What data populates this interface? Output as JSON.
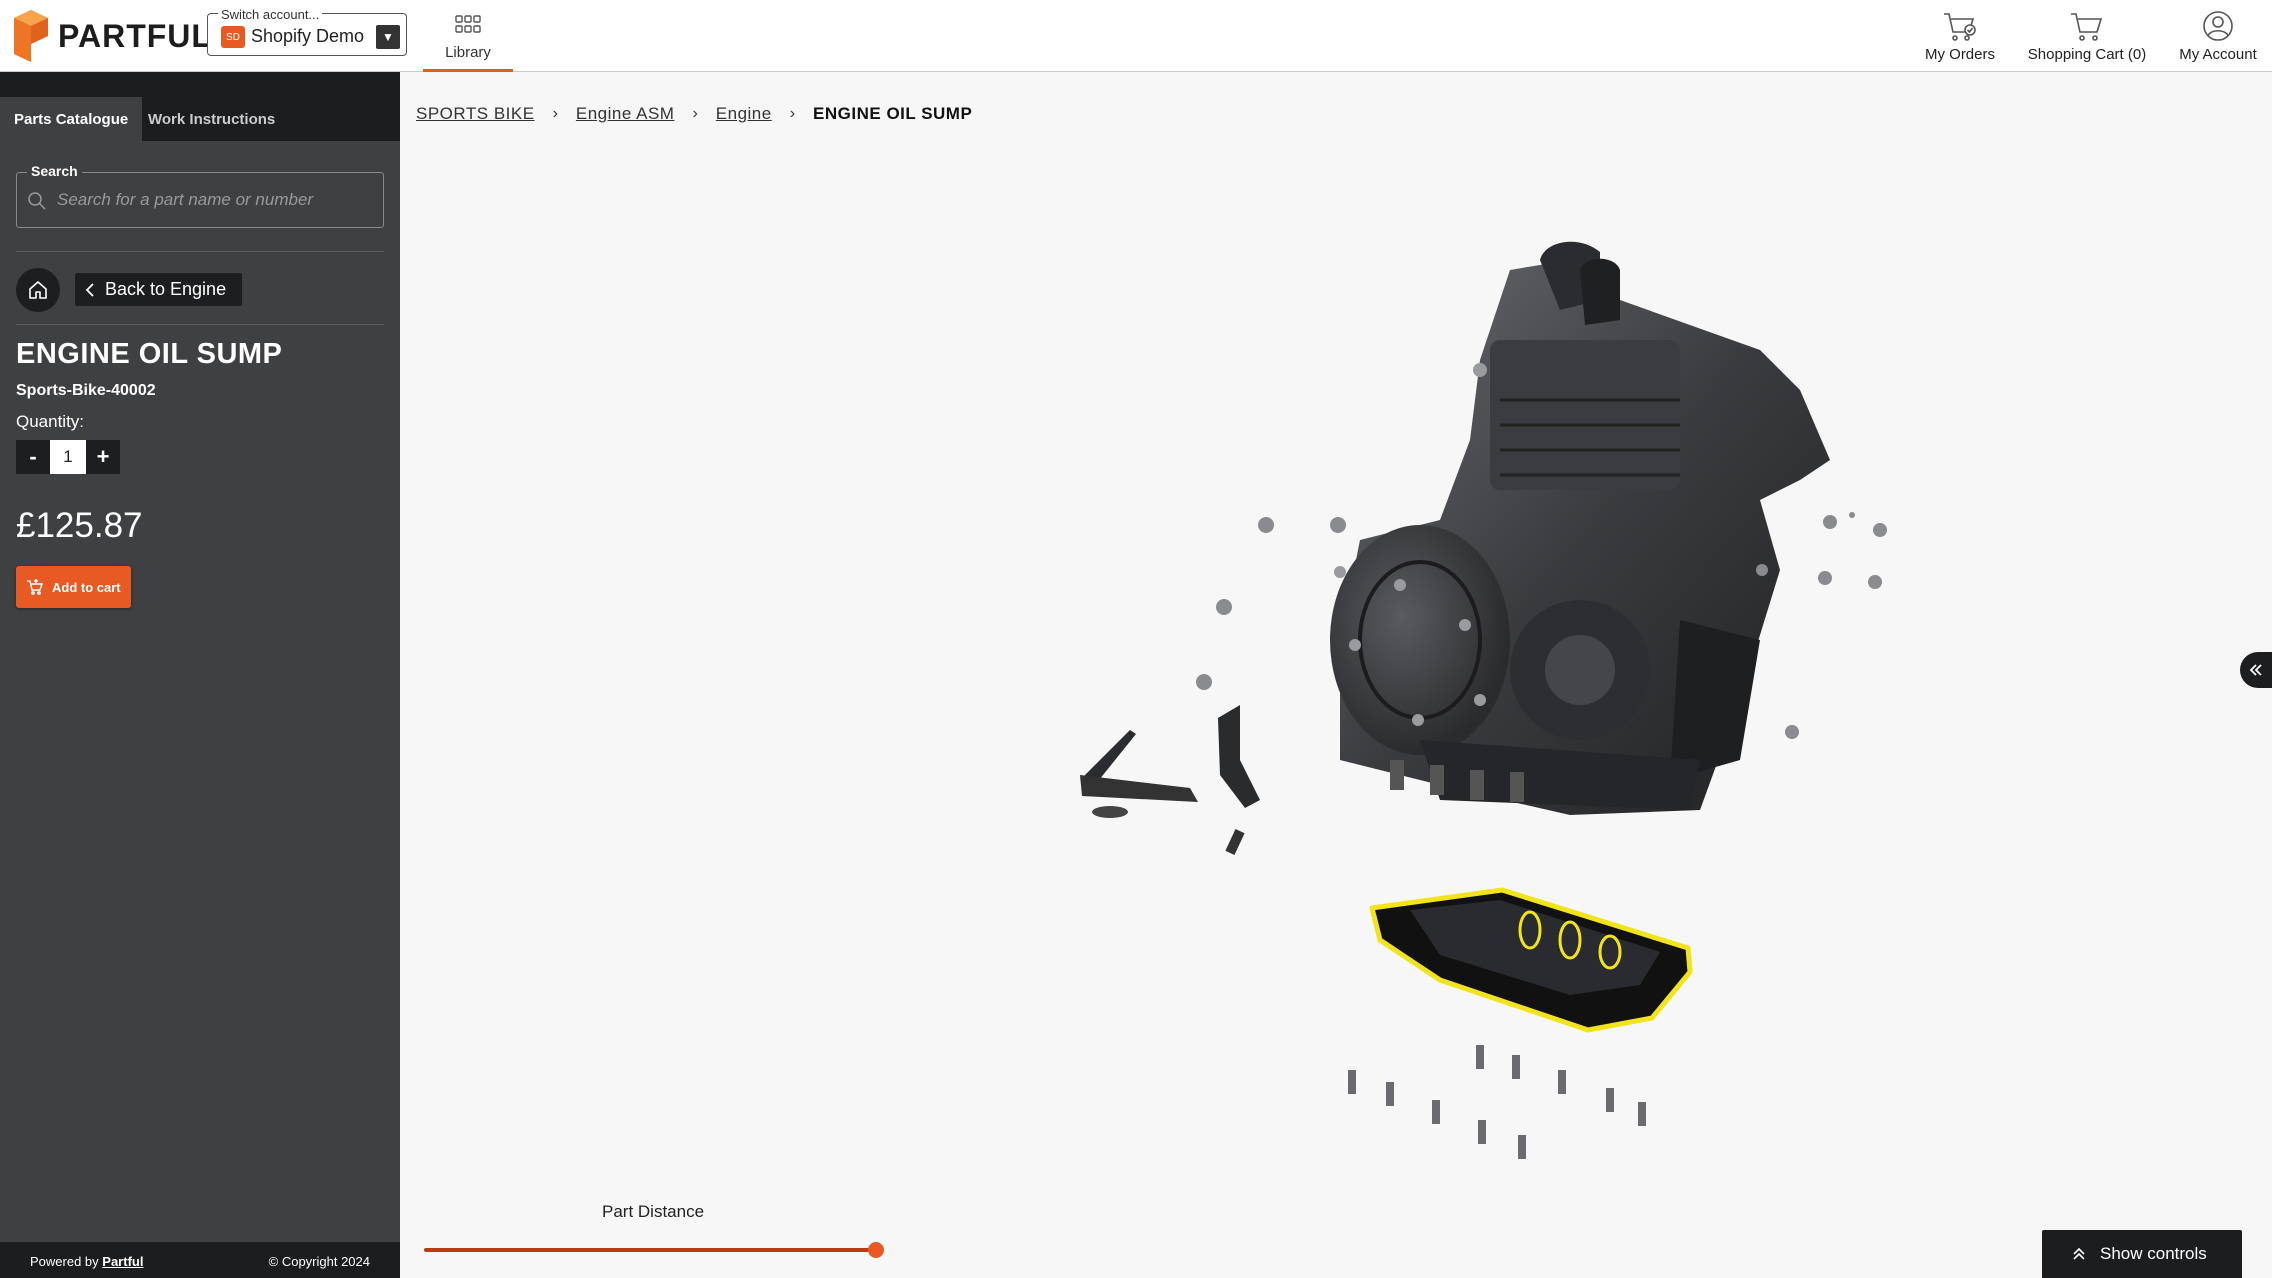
{
  "brand": {
    "name": "PARTFUL",
    "accent": "#e85a24"
  },
  "account": {
    "legend": "Switch account...",
    "badge": "SD",
    "name": "Shopify Demo"
  },
  "nav": {
    "library": "Library"
  },
  "top_actions": {
    "orders": "My Orders",
    "cart": "Shopping Cart (0)",
    "account": "My Account"
  },
  "tabs": {
    "parts": "Parts Catalogue",
    "instructions": "Work Instructions"
  },
  "search": {
    "legend": "Search",
    "placeholder": "Search for a part name or number",
    "value": ""
  },
  "back": {
    "label": "Back to Engine"
  },
  "part": {
    "title": "ENGINE OIL SUMP",
    "number": "Sports-Bike-40002",
    "quantity_label": "Quantity:",
    "quantity": "1",
    "price": "£125.87",
    "add_to_cart": "Add to cart"
  },
  "qty_buttons": {
    "minus": "-",
    "plus": "+"
  },
  "breadcrumb": [
    "SPORTS BIKE",
    "Engine ASM",
    "Engine",
    "ENGINE OIL SUMP"
  ],
  "viewer": {
    "part_distance_label": "Part Distance",
    "part_distance_fraction": 1.0,
    "show_controls": "Show controls"
  },
  "footer": {
    "powered_prefix": "Powered by",
    "powered_link": "Partful",
    "copyright": "© Copyright 2024"
  }
}
